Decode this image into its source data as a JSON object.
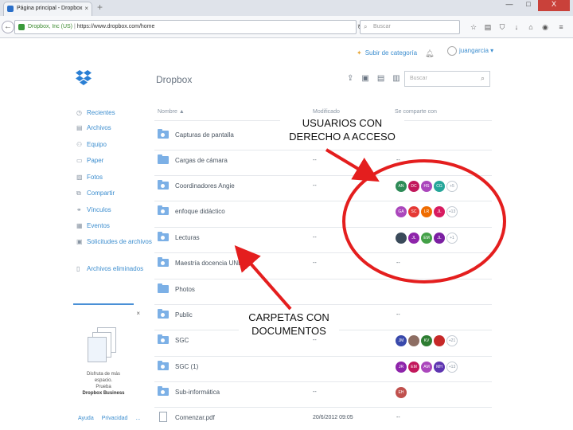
{
  "browser": {
    "tab_title": "Página principal - Dropbox",
    "tab_close": "×",
    "new_tab": "+",
    "win_min": "—",
    "win_max": "□",
    "win_close": "X",
    "url_identity": "Dropbox, Inc (US)",
    "url_text": "https://www.dropbox.com/home",
    "search_placeholder": "Buscar"
  },
  "dropbox": {
    "title": "Dropbox",
    "upgrade": "Subir de categoría",
    "user_name": "juangarcia",
    "search_placeholder": "Buscar"
  },
  "sidebar": {
    "items": [
      {
        "label": "Recientes",
        "icon": "clock-icon"
      },
      {
        "label": "Archivos",
        "icon": "files-icon"
      },
      {
        "label": "Equipo",
        "icon": "team-icon"
      },
      {
        "label": "Paper",
        "icon": "paper-icon"
      },
      {
        "label": "Fotos",
        "icon": "photos-icon"
      },
      {
        "label": "Compartir",
        "icon": "share-icon"
      },
      {
        "label": "Vínculos",
        "icon": "link-icon"
      },
      {
        "label": "Eventos",
        "icon": "events-icon"
      },
      {
        "label": "Solicitudes de archivos",
        "icon": "file-request-icon"
      },
      {
        "label": "Archivos eliminados",
        "icon": "trash-icon"
      }
    ],
    "promo_line1": "Disfruta de más",
    "promo_line2": "espacio.",
    "promo_line3": "Prueba",
    "promo_line4": "Dropbox Business",
    "promo_close": "×",
    "footer_links": [
      "Ayuda",
      "Privacidad",
      "..."
    ]
  },
  "table": {
    "col_name": "Nombre ▲",
    "col_modified": "Modificado",
    "col_shared": "Se comparte con",
    "rows": [
      {
        "name": "Capturas de pantalla",
        "modified": "",
        "shared": ""
      },
      {
        "name": "Cargas de cámara",
        "modified": "--",
        "shared": "--"
      },
      {
        "name": "Coordinadores Angie",
        "modified": "--",
        "shared": "avatars"
      },
      {
        "name": "enfoque didáctico",
        "modified": "",
        "shared": "avatars"
      },
      {
        "name": "Lecturas",
        "modified": "--",
        "shared": "avatars"
      },
      {
        "name": "Maestría docencia UNED",
        "modified": "--",
        "shared": "--"
      },
      {
        "name": "Photos",
        "modified": "",
        "shared": ""
      },
      {
        "name": "Public",
        "modified": "",
        "shared": "--"
      },
      {
        "name": "SGC",
        "modified": "--",
        "shared": "avatars"
      },
      {
        "name": "SGC (1)",
        "modified": "",
        "shared": "avatars"
      },
      {
        "name": "Sub-informática",
        "modified": "--",
        "shared": "avatars"
      },
      {
        "name": "Comenzar.pdf",
        "modified": "20/6/2012 09:05",
        "shared": "--"
      }
    ],
    "avatars": {
      "row2": {
        "items": [
          {
            "t": "AN",
            "c": "#2e8b57"
          },
          {
            "t": "DC",
            "c": "#c2185b"
          },
          {
            "t": "HS",
            "c": "#ab47bc"
          },
          {
            "t": "CG",
            "c": "#26a69a"
          }
        ],
        "more": "+5"
      },
      "row3": {
        "items": [
          {
            "t": "GA",
            "c": "#ab47bc"
          },
          {
            "t": "SC",
            "c": "#e53935"
          },
          {
            "t": "LR",
            "c": "#ef6c00"
          },
          {
            "t": "JL",
            "c": "#d81b60"
          }
        ],
        "more": "+13"
      },
      "row4": {
        "items": [
          {
            "t": "",
            "c": "#3a4a5a"
          },
          {
            "t": "JL",
            "c": "#8e24aa"
          },
          {
            "t": "EM",
            "c": "#43a047"
          },
          {
            "t": "JL",
            "c": "#7b1fa2"
          }
        ],
        "more": "+1"
      },
      "row8": {
        "items": [
          {
            "t": "JM",
            "c": "#3949ab"
          },
          {
            "t": "",
            "c": "#8d6e63"
          },
          {
            "t": "KV",
            "c": "#2e7d32"
          },
          {
            "t": "",
            "c": "#c62828"
          }
        ],
        "more": "+21"
      },
      "row9": {
        "items": [
          {
            "t": "JR",
            "c": "#8e24aa"
          },
          {
            "t": "EM",
            "c": "#c2185b"
          },
          {
            "t": "AM",
            "c": "#ab47bc"
          },
          {
            "t": "MH",
            "c": "#5e35b1"
          }
        ],
        "more": "+13"
      },
      "row10": {
        "items": [
          {
            "t": "EH",
            "c": "#c0504d"
          }
        ],
        "more": ""
      }
    }
  },
  "annotations": {
    "users_line1": "USUARIOS CON",
    "users_line2": "DERECHO A ACCESO",
    "folders_line1": "CARPETAS CON",
    "folders_line2": "DOCUMENTOS"
  },
  "colors": {
    "accent": "#3d8ecf",
    "annotation_red": "#e41e1e",
    "folder_blue": "#7cb0e6"
  }
}
